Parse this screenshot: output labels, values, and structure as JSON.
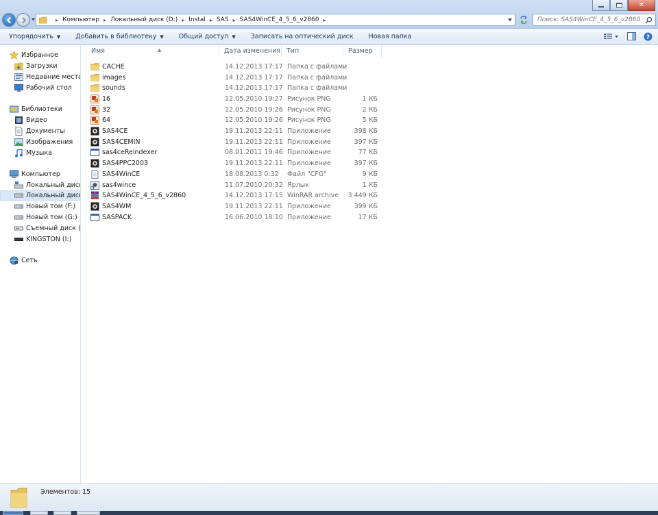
{
  "address": {
    "crumbs": [
      "Компьютер",
      "Локальный диск (D:)",
      "Instal",
      "SAS",
      "SAS4WinCE_4_5_6_v2860"
    ]
  },
  "search": {
    "placeholder": "Поиск: SAS4WinCE_4_5_6_v2860"
  },
  "toolbar": {
    "organize": "Упорядочить",
    "add_to_library": "Добавить в библиотеку",
    "share": "Общий доступ",
    "burn": "Записать на оптический диск",
    "new_folder": "Новая папка"
  },
  "sidebar": {
    "favorites": "Избранное",
    "favorites_items": [
      "Загрузки",
      "Недавние места",
      "Рабочий стол"
    ],
    "libraries": "Библиотеки",
    "libraries_items": [
      "Видео",
      "Документы",
      "Изображения",
      "Музыка"
    ],
    "computer": "Компьютер",
    "computer_items": [
      "Локальный диск (C",
      "Локальный диск (D",
      "Новый том (F:)",
      "Новый том (G:)",
      "Съемный диск (H:)",
      "KINGSTON (I:)"
    ],
    "network": "Сеть"
  },
  "columns": {
    "name": "Имя",
    "date": "Дата изменения",
    "type": "Тип",
    "size": "Размер"
  },
  "files": [
    {
      "name": "CACHE",
      "date": "14.12.2013 17:17",
      "type": "Папка с файлами",
      "size": "",
      "icon": "folder"
    },
    {
      "name": "images",
      "date": "14.12.2013 17:17",
      "type": "Папка с файлами",
      "size": "",
      "icon": "folder"
    },
    {
      "name": "sounds",
      "date": "14.12.2013 17:17",
      "type": "Папка с файлами",
      "size": "",
      "icon": "folder"
    },
    {
      "name": "16",
      "date": "12.05.2010 19:27",
      "type": "Рисунок PNG",
      "size": "1 КБ",
      "icon": "png"
    },
    {
      "name": "32",
      "date": "12.05.2010 19:26",
      "type": "Рисунок PNG",
      "size": "2 КБ",
      "icon": "png"
    },
    {
      "name": "64",
      "date": "12.05.2010 19:26",
      "type": "Рисунок PNG",
      "size": "5 КБ",
      "icon": "png"
    },
    {
      "name": "SAS4CE",
      "date": "19.11.2013 22:11",
      "type": "Приложение",
      "size": "398 КБ",
      "icon": "app"
    },
    {
      "name": "SAS4CEMIN",
      "date": "19.11.2013 22:11",
      "type": "Приложение",
      "size": "397 КБ",
      "icon": "app"
    },
    {
      "name": "sas4ceReindexer",
      "date": "08.01.2011 19:46",
      "type": "Приложение",
      "size": "77 КБ",
      "icon": "window"
    },
    {
      "name": "SAS4PPC2003",
      "date": "19.11.2013 22:11",
      "type": "Приложение",
      "size": "397 КБ",
      "icon": "app"
    },
    {
      "name": "SAS4WinCE",
      "date": "18.08.2013 0:32",
      "type": "Файл \"CFG\"",
      "size": "9 КБ",
      "icon": "doc"
    },
    {
      "name": "sas4wince",
      "date": "11.07.2010 20:32",
      "type": "Ярлык",
      "size": "1 КБ",
      "icon": "shortcut"
    },
    {
      "name": "SAS4WinCE_4_5_6_v2860",
      "date": "14.12.2013 17:15",
      "type": "WinRAR archive",
      "size": "3 449 КБ",
      "icon": "rar"
    },
    {
      "name": "SAS4WM",
      "date": "19.11.2013 22:11",
      "type": "Приложение",
      "size": "399 КБ",
      "icon": "app"
    },
    {
      "name": "SASPACK",
      "date": "16.06.2010 18:10",
      "type": "Приложение",
      "size": "17 КБ",
      "icon": "window"
    }
  ],
  "status": {
    "items_label": "Элементов: 15"
  },
  "colors": {
    "folder": "#e8c25a",
    "accent": "#1c5fb0",
    "selection": "#d9e8f8"
  }
}
